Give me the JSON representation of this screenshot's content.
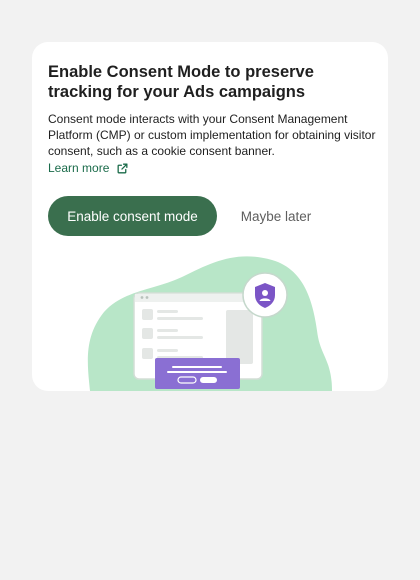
{
  "card": {
    "title": "Enable Consent Mode to preserve tracking for your Ads campaigns",
    "description": "Consent mode interacts with your Consent Management Platform (CMP) or custom implementation for obtaining visitor consent, such as a cookie consent banner.",
    "learn_more_label": "Learn more",
    "learn_more_icon": "external-link-icon"
  },
  "actions": {
    "enable_label": "Enable consent mode",
    "later_label": "Maybe later"
  },
  "illustration": {
    "icon": "shield-person-icon"
  },
  "colors": {
    "primary_button": "#3a6f4e",
    "link": "#1a6b4a",
    "blob": "#b8e6c8",
    "banner": "#8a6fd3",
    "shield": "#7b55c6"
  }
}
